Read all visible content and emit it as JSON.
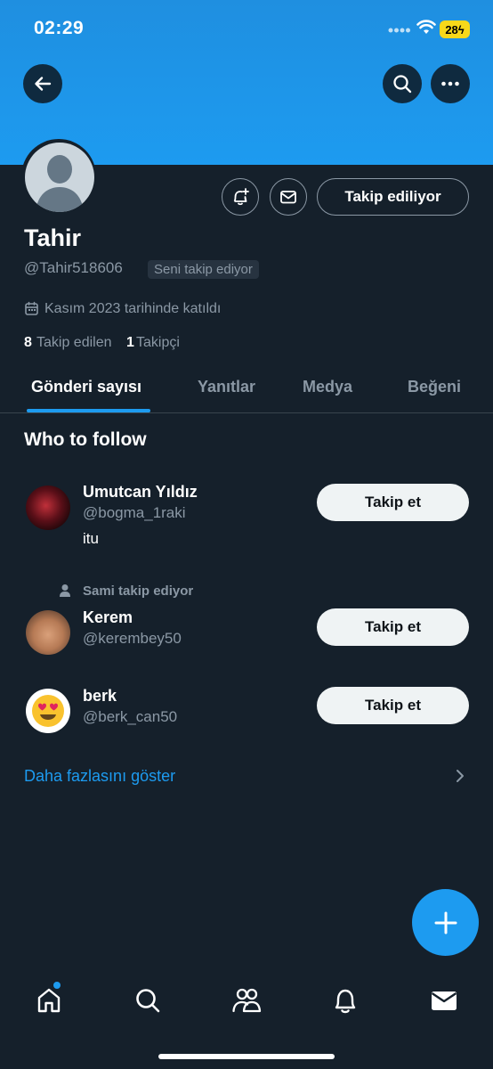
{
  "status_bar": {
    "time": "02:29",
    "battery": "28"
  },
  "profile": {
    "name": "Tahir",
    "handle": "@Tahir518606",
    "follows_you_badge": "Seni takip ediyor",
    "joined": "Kasım 2023 tarihinde katıldı",
    "following_count": "8",
    "following_label": "Takip edilen",
    "followers_count": "1",
    "followers_label": "Takipçi",
    "following_button": "Takip ediliyor"
  },
  "tabs": [
    {
      "label": "Gönderi sayısı",
      "active": true
    },
    {
      "label": "Yanıtlar"
    },
    {
      "label": "Medya"
    },
    {
      "label": "Beğeni"
    }
  ],
  "who_to_follow": {
    "title": "Who to follow",
    "users": [
      {
        "name": "Umutcan Yıldız",
        "handle": "@bogma_1raki",
        "bio": "itu",
        "button": "Takip et"
      },
      {
        "social_context": "Sami takip ediyor",
        "name": "Kerem",
        "handle": "@kerembey50",
        "button": "Takip et"
      },
      {
        "name": "berk",
        "handle": "@berk_can50",
        "avatar_emoji": "😍",
        "button": "Takip et"
      }
    ],
    "show_more": "Daha fazlasını göster"
  },
  "colors": {
    "accent": "#1d9bf0",
    "background": "#15202b",
    "secondary_text": "#8b98a5"
  },
  "icons": [
    "back-arrow-icon",
    "search-icon",
    "more-icon",
    "bell-plus-icon",
    "mail-icon",
    "calendar-icon",
    "person-icon",
    "chevron-right-icon",
    "plus-icon",
    "home-icon",
    "communities-icon",
    "bell-icon",
    "envelope-icon"
  ]
}
